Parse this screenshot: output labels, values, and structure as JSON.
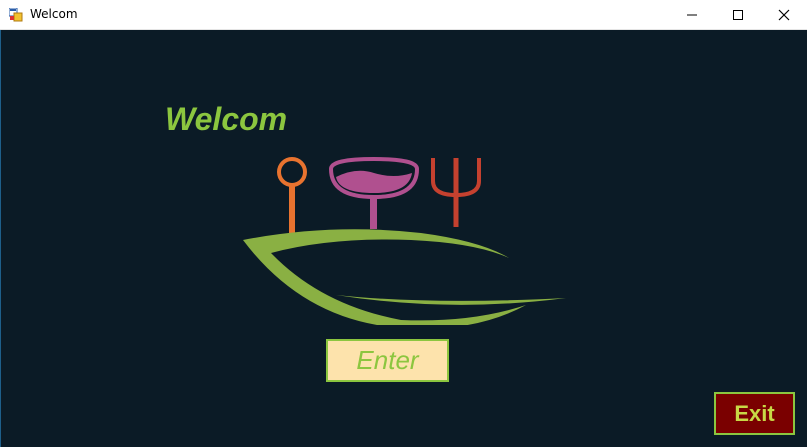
{
  "window": {
    "title": "Welcom",
    "icon": "app-icon",
    "controls": [
      "minimize-icon",
      "maximize-icon",
      "close-icon"
    ]
  },
  "main": {
    "heading": "Welcom",
    "logo": {
      "icons": [
        "spoon-icon",
        "wine-glass-icon",
        "fork-icon",
        "leaf-icon"
      ]
    },
    "enter_label": "Enter",
    "exit_label": "Exit"
  },
  "colors": {
    "background": "#0b1b26",
    "accent_green": "#8cc63f",
    "enter_bg": "#fde3ac",
    "exit_bg": "#7a0000",
    "spoon": "#e8732f",
    "glass": "#b0508f",
    "fork": "#c5412f"
  }
}
